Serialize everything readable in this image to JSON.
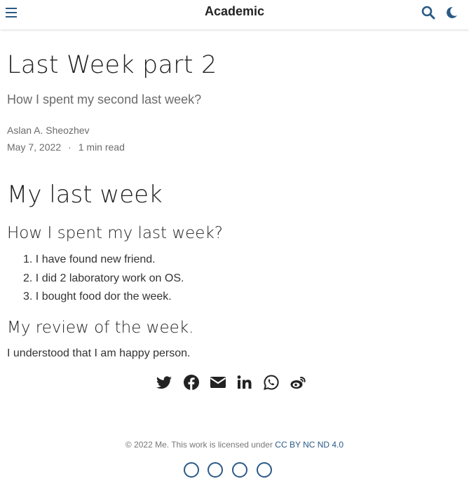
{
  "navbar": {
    "brand": "Academic",
    "menu_icon": "hamburger-icon",
    "search_icon": "search-icon",
    "theme_icon": "moon-icon"
  },
  "article": {
    "title": "Last Week part 2",
    "subtitle": "How I spent my second last week?",
    "author": "Aslan A. Sheozhev",
    "date": "May 7, 2022",
    "separator": "·",
    "reading_time": "1 min read"
  },
  "content": {
    "heading1": "My last week",
    "heading2_a": "How I spent my last week?",
    "list": [
      {
        "num": "1.",
        "text": "I have found new friend."
      },
      {
        "num": "2.",
        "text": "I did 2 laboratory work on OS."
      },
      {
        "num": "3.",
        "text": "I bought food dor the week."
      }
    ],
    "heading2_b": "My review of the week.",
    "paragraph": "I understood that I am happy person."
  },
  "share": {
    "icons": [
      "twitter-icon",
      "facebook-icon",
      "email-icon",
      "linkedin-icon",
      "whatsapp-icon",
      "weibo-icon"
    ]
  },
  "footer": {
    "text": "© 2022 Me. This work is licensed under ",
    "license_link": "CC BY NC ND 4.0",
    "icons": [
      "cc-icon",
      "by-icon",
      "nc-icon",
      "nd-icon"
    ]
  },
  "colors": {
    "accent": "#2a5a86",
    "text": "#222222",
    "muted": "#6b6b6b"
  }
}
